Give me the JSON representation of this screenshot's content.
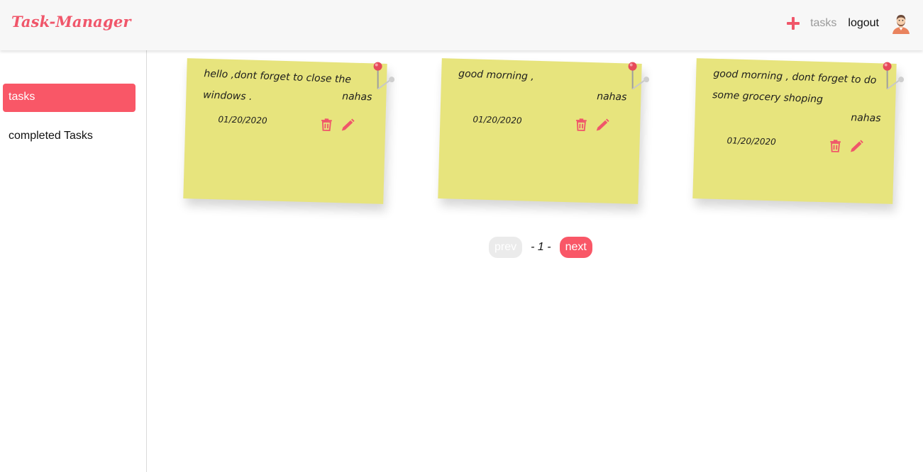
{
  "header": {
    "logo": "Task-Manager",
    "nav": {
      "tasks_label": "tasks",
      "logout_label": "logout"
    }
  },
  "sidebar": {
    "items": [
      {
        "label": "tasks",
        "active": true
      },
      {
        "label": "completed Tasks",
        "active": false
      }
    ]
  },
  "notes": [
    {
      "text": "hello ,dont forget to close the windows .",
      "author": "nahas",
      "date": "01/20/2020"
    },
    {
      "text": "good morning ,",
      "author": "nahas",
      "date": "01/20/2020"
    },
    {
      "text": "good morning , dont forget to do some grocery shoping",
      "author": "nahas",
      "date": "01/20/2020"
    }
  ],
  "pagination": {
    "prev_label": "prev",
    "page_label": "- 1 -",
    "next_label": "next"
  },
  "colors": {
    "accent": "#f95767",
    "note": "#e7e47d",
    "header_bg": "#f7f7f7"
  },
  "icons": [
    "plus-icon",
    "avatar-icon",
    "trash-icon",
    "pencil-icon",
    "pushpin-icon"
  ]
}
